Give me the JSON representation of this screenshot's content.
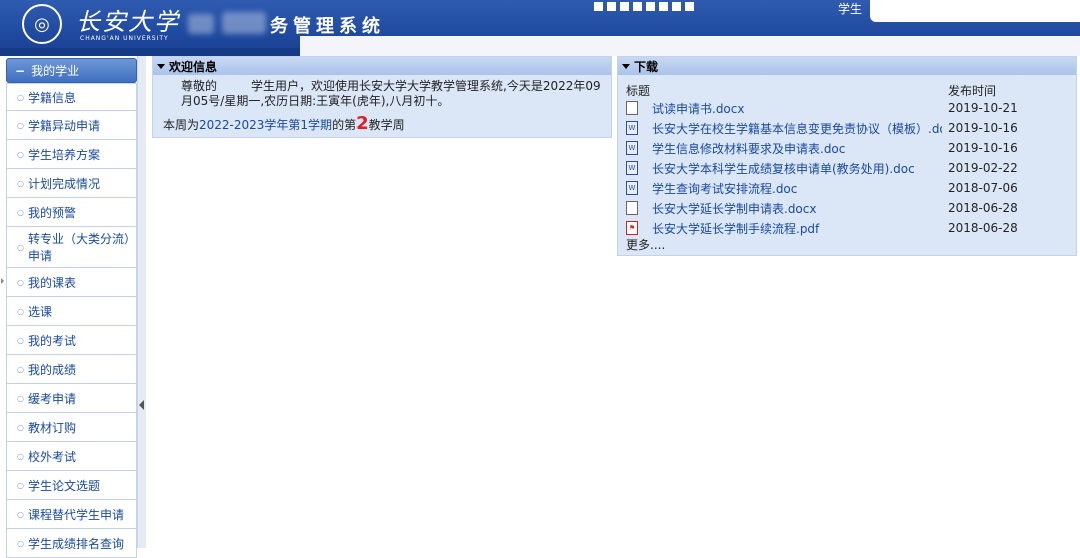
{
  "header": {
    "logo_cn": "长安大学",
    "logo_en": "CHANG'AN UNIVERSITY",
    "system_title": "务管理系统",
    "role_label": "学生"
  },
  "sidebar": {
    "section_title": "我的学业",
    "items": [
      {
        "label": "学籍信息"
      },
      {
        "label": "学籍异动申请"
      },
      {
        "label": "学生培养方案"
      },
      {
        "label": "计划完成情况"
      },
      {
        "label": "我的预警"
      },
      {
        "label": "转专业（大类分流）申请"
      },
      {
        "label": "我的课表"
      },
      {
        "label": "选课"
      },
      {
        "label": "我的考试"
      },
      {
        "label": "我的成绩"
      },
      {
        "label": "缓考申请"
      },
      {
        "label": "教材订购"
      },
      {
        "label": "校外考试"
      },
      {
        "label": "学生论文选题"
      },
      {
        "label": "课程替代学生申请"
      },
      {
        "label": "学生成绩排名查询"
      }
    ]
  },
  "welcome": {
    "title": "欢迎信息",
    "greeting": "尊敬的",
    "message": "学生用户，欢迎使用长安大学大学教学管理系统,今天是2022年09月05号/星期一,农历日期:王寅年(虎年),八月初十。",
    "week_prefix": "本周为",
    "term": "2022-2023学年第1学期",
    "week_mid": "的第",
    "week_number": "2",
    "week_suffix": "教学周"
  },
  "download": {
    "title": "下载",
    "col_title": "标题",
    "col_date": "发布时间",
    "items": [
      {
        "title": "试读申请书.docx",
        "date": "2019-10-21",
        "icon": "blank-doc-icon"
      },
      {
        "title": "长安大学在校生学籍基本信息变更免责协议（模板）.doc",
        "date": "2019-10-16",
        "icon": "word-doc-icon"
      },
      {
        "title": "学生信息修改材料要求及申请表.doc",
        "date": "2019-10-16",
        "icon": "word-doc-icon"
      },
      {
        "title": "长安大学本科学生成绩复核申请单(教务处用).doc",
        "date": "2019-02-22",
        "icon": "word-doc-icon"
      },
      {
        "title": "学生查询考试安排流程.doc",
        "date": "2018-07-06",
        "icon": "word-doc-icon"
      },
      {
        "title": "长安大学延长学制申请表.docx",
        "date": "2018-06-28",
        "icon": "blank-doc-icon"
      },
      {
        "title": "长安大学延长学制手续流程.pdf",
        "date": "2018-06-28",
        "icon": "pdf-icon"
      }
    ],
    "more_label": "更多...."
  }
}
